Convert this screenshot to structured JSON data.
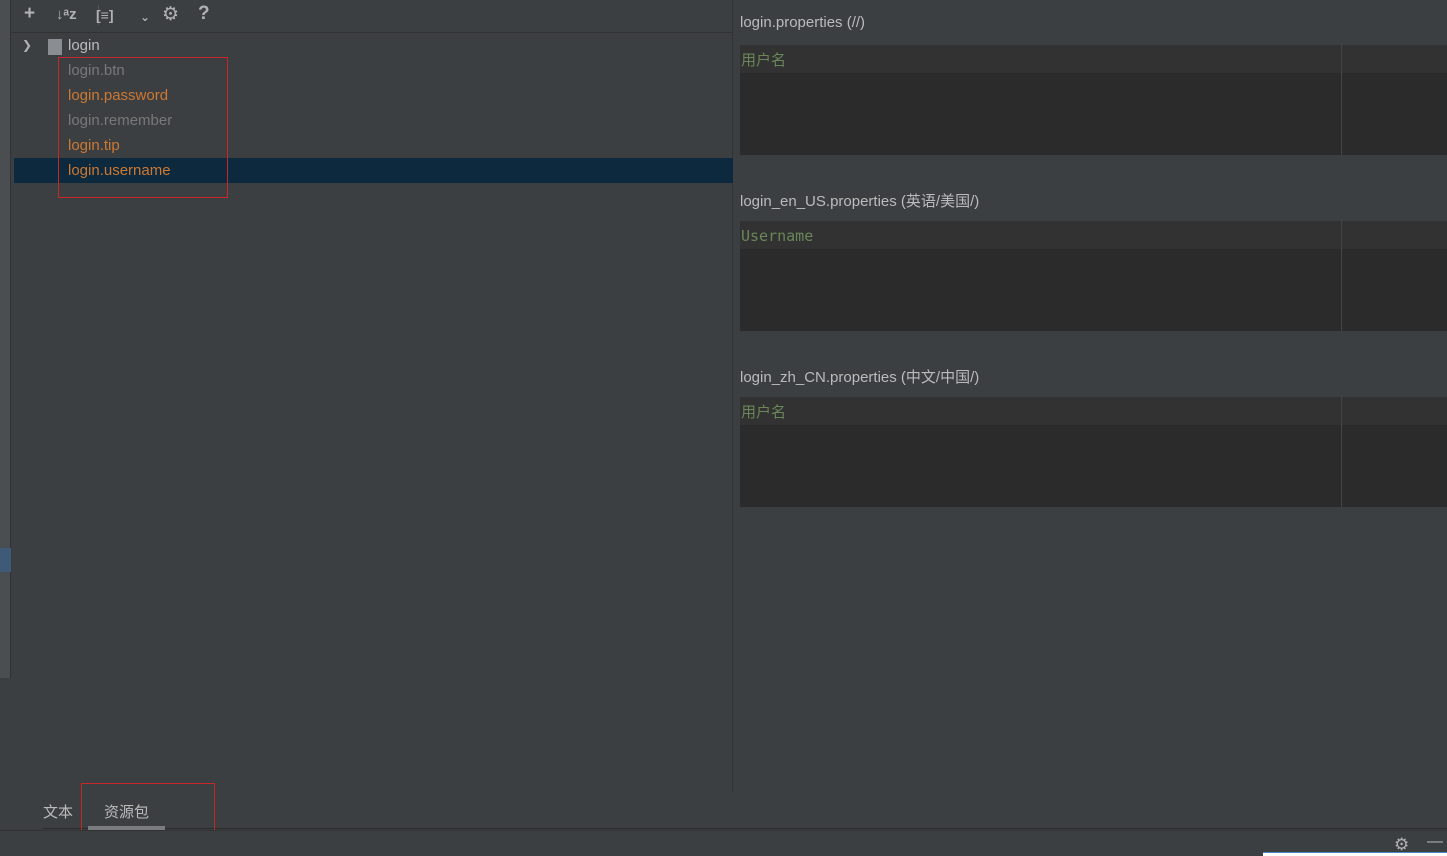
{
  "toolbar": {
    "add": "+",
    "sort": "↓ᵃz",
    "group": "[≡]",
    "dropdown": "⌄",
    "settings": "⚙",
    "help": "?"
  },
  "tree": {
    "root": "login",
    "items": [
      {
        "label": "login.btn",
        "state": "unused"
      },
      {
        "label": "login.password",
        "state": "warning"
      },
      {
        "label": "login.remember",
        "state": "unused"
      },
      {
        "label": "login.tip",
        "state": "warning"
      },
      {
        "label": "login.username",
        "state": "warning",
        "selected": true
      }
    ]
  },
  "editors": [
    {
      "title": "login.properties (//)",
      "value": "用户名"
    },
    {
      "title": "login_en_US.properties (英语/美国/)",
      "value": "Username"
    },
    {
      "title": "login_zh_CN.properties (中文/中国/)",
      "value": "用户名"
    }
  ],
  "tabs": [
    {
      "label": "文本"
    },
    {
      "label": "资源包",
      "active": true
    }
  ],
  "status": {
    "settings": "⚙",
    "minimize": "—"
  },
  "colors": {
    "warning": "#cc7832",
    "unused": "#787878",
    "selection": "#0d293e",
    "value": "#6a8759"
  }
}
